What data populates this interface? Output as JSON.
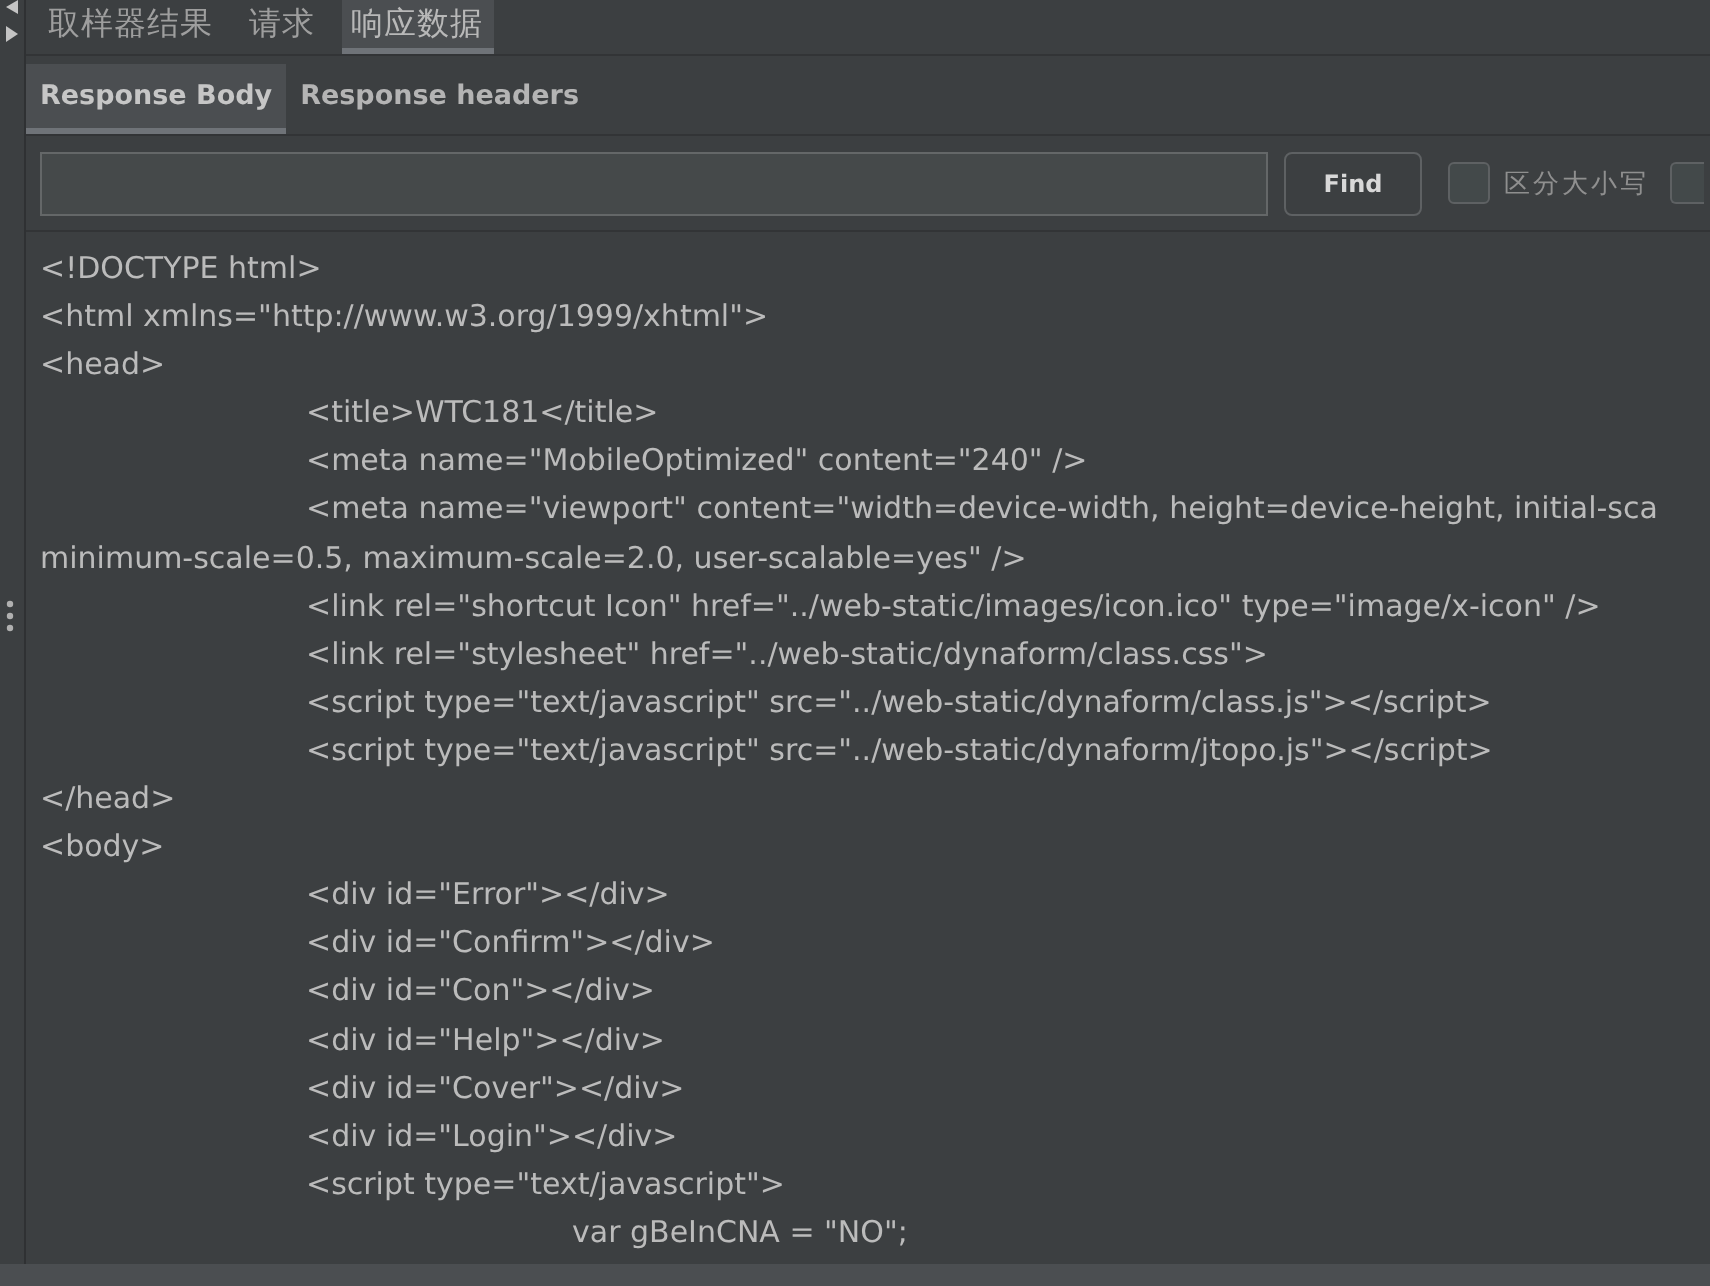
{
  "tabs": [
    {
      "label": "取样器结果",
      "selected": false
    },
    {
      "label": "请求",
      "selected": false
    },
    {
      "label": "响应数据",
      "selected": true
    }
  ],
  "subtabs": [
    {
      "label": "Response Body",
      "selected": true
    },
    {
      "label": "Response headers",
      "selected": false
    }
  ],
  "search": {
    "button": "Find",
    "options": [
      {
        "label": "区分大小写",
        "checked": false
      },
      {
        "checked": false
      }
    ]
  },
  "code_lines": [
    "<!DOCTYPE html>",
    "<html xmlns=\"http://www.w3.org/1999/xhtml\">",
    "<head>",
    "\t<title>WTC181</title>",
    "\t<meta name=\"MobileOptimized\" content=\"240\" />",
    "\t<meta name=\"viewport\" content=\"width=device-width, height=device-height, initial-sca",
    "minimum-scale=0.5, maximum-scale=2.0, user-scalable=yes\" />",
    "\t<link rel=\"shortcut Icon\" href=\"../web-static/images/icon.ico\" type=\"image/x-icon\" />",
    "\t<link rel=\"stylesheet\" href=\"../web-static/dynaform/class.css\">",
    "\t<script type=\"text/javascript\" src=\"../web-static/dynaform/class.js\"></script>",
    "\t<script type=\"text/javascript\" src=\"../web-static/dynaform/jtopo.js\"></script>",
    "</head>",
    "<body>",
    "\t<div id=\"Error\"></div>",
    "\t<div id=\"Confirm\"></div>",
    "\t<div id=\"Con\"></div>",
    "\t<div id=\"Help\"></div>",
    "\t<div id=\"Cover\"></div>",
    "\t<div id=\"Login\"></div>",
    "\t<script type=\"text/javascript\">",
    "\t\tvar gBeInCNA = \"NO\";"
  ]
}
